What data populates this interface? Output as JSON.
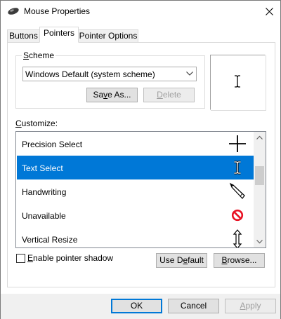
{
  "window": {
    "title": "Mouse Properties"
  },
  "tabs": [
    {
      "label": "Buttons"
    },
    {
      "label": "Pointers"
    },
    {
      "label": "Pointer Options"
    }
  ],
  "scheme": {
    "label_accel": "S",
    "label_rest": "cheme",
    "selected": "Windows Default (system scheme)",
    "save_as": {
      "pre": "Sa",
      "accel": "v",
      "post": "e As..."
    },
    "delete": {
      "accel": "D",
      "post": "elete"
    }
  },
  "customize": {
    "label_accel": "C",
    "label_rest": "ustomize:",
    "items": [
      {
        "label": "Precision Select",
        "icon": "crosshair-icon",
        "selected": false
      },
      {
        "label": "Text Select",
        "icon": "text-cursor-icon",
        "selected": true
      },
      {
        "label": "Handwriting",
        "icon": "pen-icon",
        "selected": false
      },
      {
        "label": "Unavailable",
        "icon": "unavailable-icon",
        "selected": false
      },
      {
        "label": "Vertical Resize",
        "icon": "vertical-resize-icon",
        "selected": false
      }
    ]
  },
  "shadow": {
    "label_accel": "E",
    "label_rest": "nable pointer shadow",
    "checked": false
  },
  "buttons": {
    "use_default": {
      "pre": "Use D",
      "accel": "e",
      "post": "fault"
    },
    "browse": {
      "accel": "B",
      "post": "rowse..."
    },
    "ok": "OK",
    "cancel": "Cancel",
    "apply": {
      "accel": "A",
      "post": "pply"
    }
  },
  "colors": {
    "selection": "#0078d7",
    "unavailable_red": "#e81123"
  }
}
